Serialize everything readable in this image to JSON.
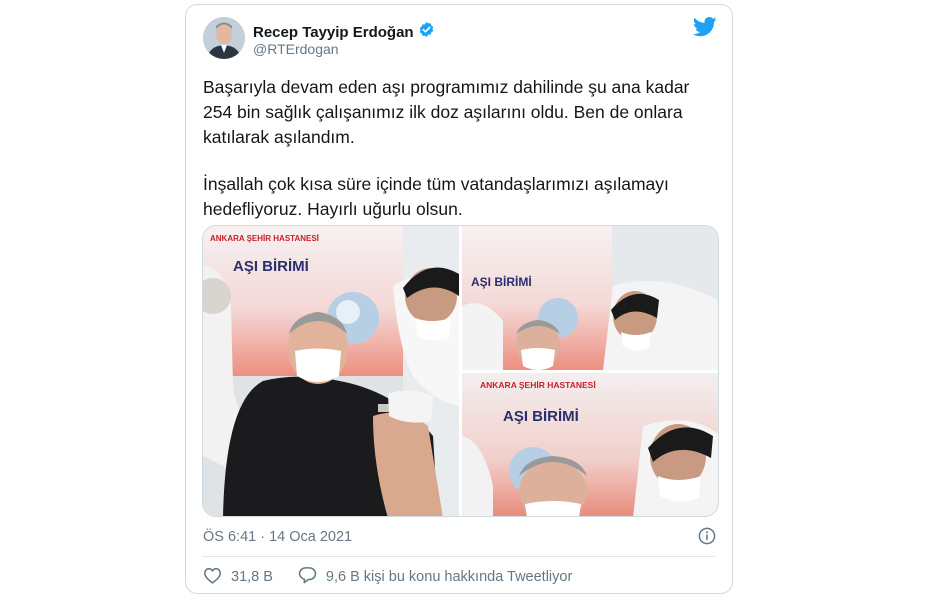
{
  "tweet": {
    "author_name": "Recep Tayyip Erdoğan",
    "author_handle": "@RTErdogan",
    "verified": true,
    "paragraphs": [
      "Başarıyla devam eden aşı programımız dahilinde şu ana kadar\n254 bin sağlık çalışanımız ilk doz aşılarını oldu. Ben de onlara\nkatılarak aşılandım.",
      "İnşallah çok kısa süre içinde tüm vatandaşlarımızı aşılamayı\nhedefliyoruz. Hayırlı uğurlu olsun."
    ],
    "timestamp": "ÖS 6:41 · 14 Oca 2021",
    "like_count": "31,8 B",
    "reply_text": "9,6 B kişi bu konu hakkında Tweetliyor"
  },
  "media": {
    "photo1_sign_top": "ANKARA ŞEHİR HASTANESİ",
    "photo1_sign_main": "AŞI BİRİMİ",
    "photo2_sign_main": "AŞI BİRİMİ",
    "photo3_sign_top": "ANKARA ŞEHİR HASTANESİ",
    "photo3_sign_main": "AŞI BİRİMİ"
  },
  "icons": {
    "verified": "verified-badge-icon",
    "bird": "twitter-bird-icon",
    "info": "info-icon",
    "like": "heart-icon",
    "reply": "reply-bubble-icon"
  },
  "colors": {
    "brand": "#1da1f2",
    "text": "#14171a",
    "muted": "#657786",
    "border": "#cfd9de",
    "sign_red": "#c8202d",
    "sign_navy": "#2a2f6e"
  }
}
